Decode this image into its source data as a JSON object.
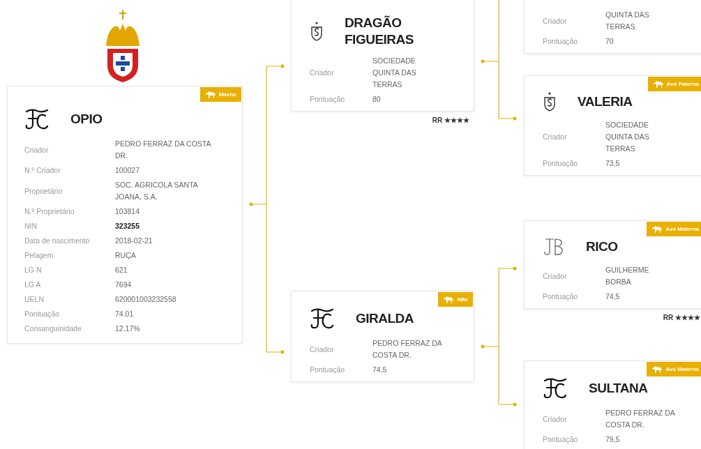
{
  "cards": [
    {
      "badge": "Macho",
      "kind": "fc",
      "name": "OPIO",
      "rows": [
        {
          "label": "Criador",
          "value": "PEDRO FERRAZ DA COSTA DR.",
          "bold": false
        },
        {
          "label": "N.º Criador",
          "value": "100027",
          "bold": false
        },
        {
          "label": "Proprietário",
          "value": "SOC. AGRICOLA SANTA JOANA, S.A.",
          "bold": false
        },
        {
          "label": "N.º Proprietário",
          "value": "103814",
          "bold": false
        },
        {
          "label": "NIN",
          "value": "323255",
          "bold": true
        },
        {
          "label": "Data de nascimento",
          "value": "2018-02-21",
          "bold": false
        },
        {
          "label": "Pelagem",
          "value": "RUÇA",
          "bold": false
        },
        {
          "label": "LG N",
          "value": "621",
          "bold": false
        },
        {
          "label": "LG A",
          "value": "7694",
          "bold": false
        },
        {
          "label": "UELN",
          "value": "620001003232558",
          "bold": false
        },
        {
          "label": "Pontuação",
          "value": "74.01",
          "bold": false
        },
        {
          "label": "Consanguinidade",
          "value": "12.17%",
          "bold": false
        }
      ]
    },
    {
      "kind": "shield",
      "name": "DRAGÃO FIGUEIRAS",
      "rows": [
        {
          "label": "Criador",
          "value": "SOCIEDADE QUINTA DAS TERRAS",
          "bold": false
        },
        {
          "label": "Pontuação",
          "value": "80",
          "bold": false
        }
      ],
      "rating": "RR ★★★★"
    },
    {
      "rows": [
        {
          "label": "Criador",
          "value": "QUINTA DAS TERRAS",
          "bold": false
        },
        {
          "label": "Pontuação",
          "value": "70",
          "bold": false
        }
      ]
    },
    {
      "badge": "Avó Paterna",
      "kind": "shield",
      "name": "VALERIA",
      "rows": [
        {
          "label": "Criador",
          "value": "SOCIEDADE QUINTA DAS TERRAS",
          "bold": false
        },
        {
          "label": "Pontuação",
          "value": "73,5",
          "bold": false
        }
      ]
    },
    {
      "badge": "Avó Materna",
      "kind": "jb",
      "name": "RICO",
      "rows": [
        {
          "label": "Criador",
          "value": "GUILHERME BORBA",
          "bold": false
        },
        {
          "label": "Pontuação",
          "value": "74,5",
          "bold": false
        }
      ],
      "rating": "RR ★★★★"
    },
    {
      "badge": "Mãe",
      "kind": "fc",
      "name": "GIRALDA",
      "rows": [
        {
          "label": "Criador",
          "value": "PEDRO FERRAZ DA COSTA DR.",
          "bold": false
        },
        {
          "label": "Pontuação",
          "value": "74,5",
          "bold": false
        }
      ]
    },
    {
      "badge": "Avó Materna",
      "kind": "fc",
      "name": "SULTANA",
      "rows": [
        {
          "label": "Criador",
          "value": "PEDRO FERRAZ DA COSTA DR.",
          "bold": false
        },
        {
          "label": "Pontuação",
          "value": "79,5",
          "bold": false
        }
      ]
    }
  ]
}
